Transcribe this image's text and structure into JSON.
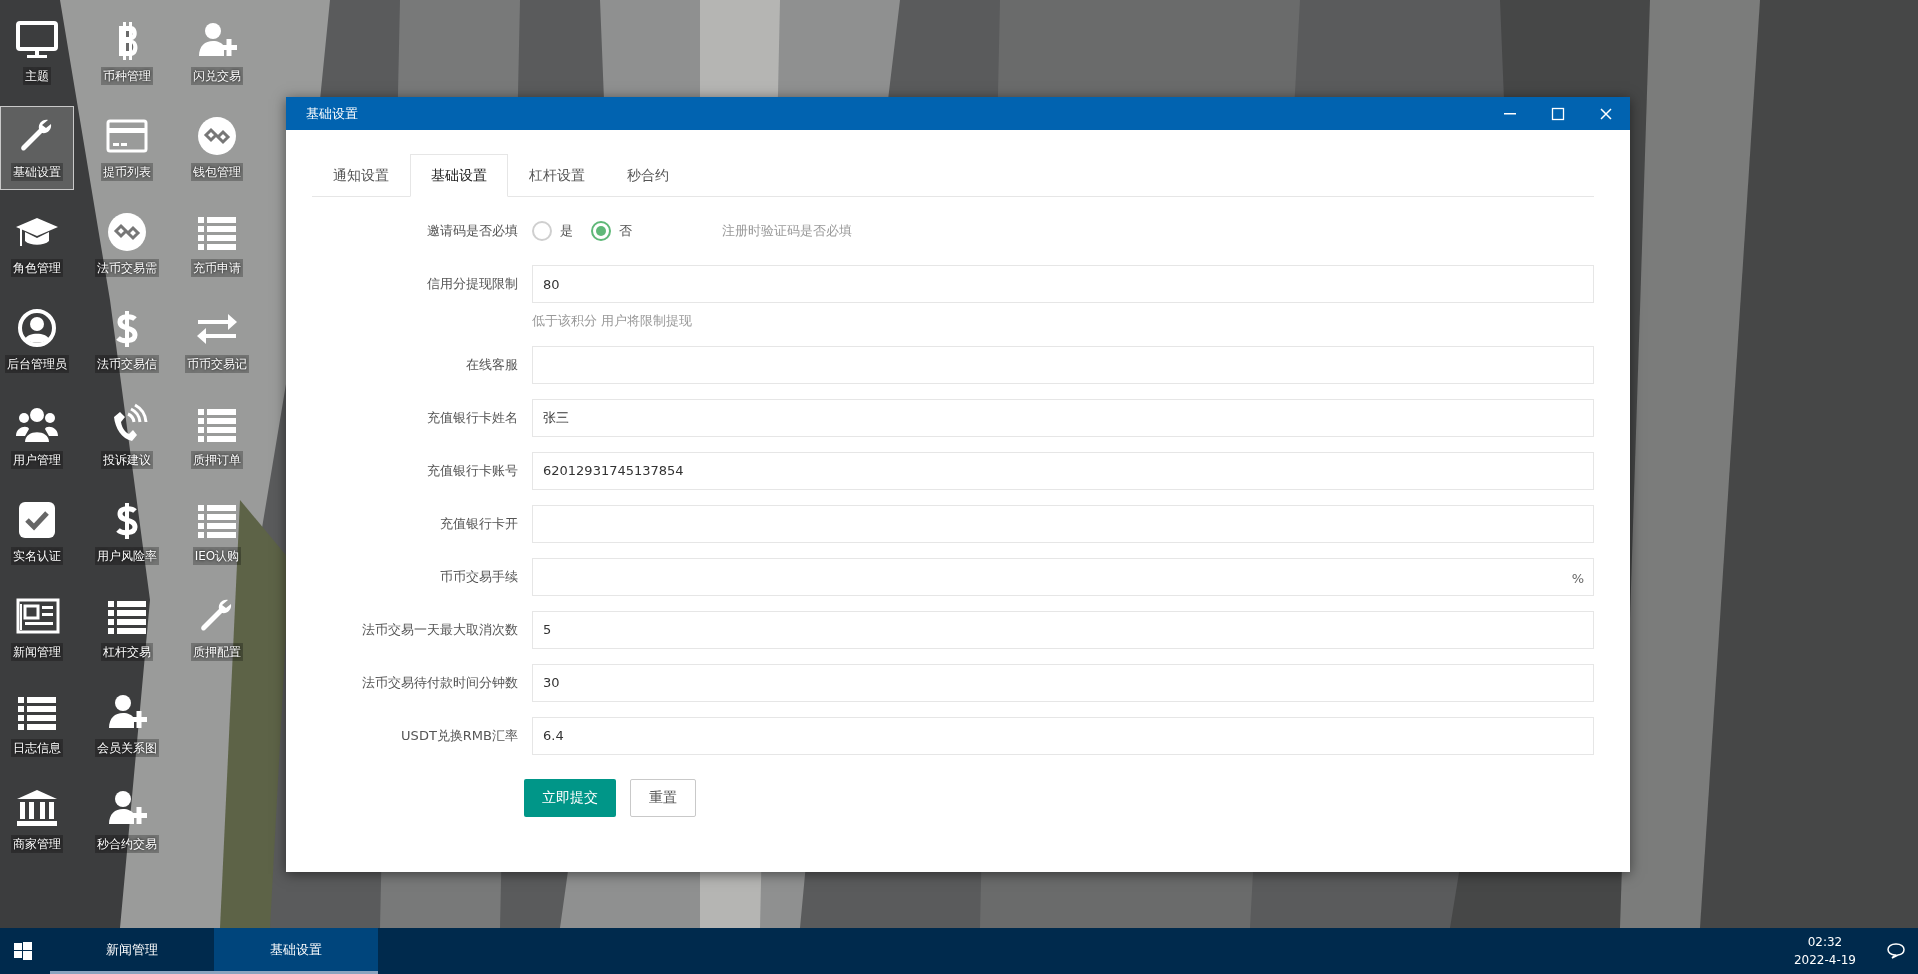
{
  "desktop_icons": [
    {
      "label": "主题",
      "kind": "monitor",
      "selected": false
    },
    {
      "label": "币种管理",
      "kind": "bitcoin",
      "selected": false
    },
    {
      "label": "闪兑交易",
      "kind": "user-plus",
      "selected": false
    },
    {
      "label": "基础设置",
      "kind": "wrench",
      "selected": true
    },
    {
      "label": "提币列表",
      "kind": "card",
      "selected": false
    },
    {
      "label": "钱包管理",
      "kind": "chain",
      "selected": false
    },
    {
      "label": "角色管理",
      "kind": "cap",
      "selected": false
    },
    {
      "label": "法币交易需",
      "kind": "chain",
      "selected": false
    },
    {
      "label": "充币申请",
      "kind": "list",
      "selected": false
    },
    {
      "label": "后台管理员",
      "kind": "user-circle",
      "selected": false
    },
    {
      "label": "法币交易信",
      "kind": "dollar",
      "selected": false
    },
    {
      "label": "币币交易记",
      "kind": "arrows",
      "selected": false
    },
    {
      "label": "用户管理",
      "kind": "users",
      "selected": false
    },
    {
      "label": "投诉建议",
      "kind": "phone",
      "selected": false
    },
    {
      "label": "质押订单",
      "kind": "list",
      "selected": false
    },
    {
      "label": "实名认证",
      "kind": "check",
      "selected": false
    },
    {
      "label": "用户风险率",
      "kind": "dollar",
      "selected": false
    },
    {
      "label": "IEO认购",
      "kind": "list",
      "selected": false
    },
    {
      "label": "新闻管理",
      "kind": "news",
      "selected": false
    },
    {
      "label": "杠杆交易",
      "kind": "list",
      "selected": false
    },
    {
      "label": "质押配置",
      "kind": "wrench",
      "selected": false
    },
    {
      "label": "日志信息",
      "kind": "list",
      "selected": false
    },
    {
      "label": "会员关系图",
      "kind": "user-plus",
      "selected": false
    },
    {
      "kind": "spacer"
    },
    {
      "label": "商家管理",
      "kind": "bank",
      "selected": false
    },
    {
      "label": "秒合约交易",
      "kind": "user-plus",
      "selected": false
    }
  ],
  "window": {
    "title": "基础设置",
    "tabs": [
      {
        "label": "通知设置",
        "selected": false
      },
      {
        "label": "基础设置",
        "selected": true
      },
      {
        "label": "杠杆设置",
        "selected": false
      },
      {
        "label": "秒合约",
        "selected": false
      }
    ],
    "rows": [
      {
        "kind": "radio",
        "label": "邀请码是否必填",
        "options": [
          {
            "label": "是",
            "selected": false
          },
          {
            "label": "否",
            "selected": true
          }
        ],
        "hint": "注册时验证码是否必填"
      },
      {
        "kind": "input",
        "label": "信用分提现限制",
        "value": "80",
        "help": "低于该积分 用户将限制提现"
      },
      {
        "kind": "input",
        "label": "在线客服"
      },
      {
        "kind": "input",
        "label": "充值银行卡姓名",
        "value": "张三"
      },
      {
        "kind": "input",
        "label": "充值银行卡账号",
        "value": "62012931745137854"
      },
      {
        "kind": "input",
        "label": "充值银行卡开"
      },
      {
        "kind": "input",
        "label": "币币交易手续",
        "suffix": "%"
      },
      {
        "kind": "input",
        "label": "法币交易一天最大取消次数",
        "value": "5"
      },
      {
        "kind": "input",
        "label": "法币交易待付款时间分钟数",
        "value": "30"
      },
      {
        "kind": "input",
        "label": "USDT兑换RMB汇率",
        "value": "6.4"
      }
    ],
    "buttons": [
      {
        "label": "立即提交",
        "kind": "primary"
      },
      {
        "label": "重置",
        "kind": "secondary"
      }
    ]
  },
  "taskbar": {
    "items": [
      {
        "label": "新闻管理",
        "selected": false
      },
      {
        "label": "基础设置",
        "selected": true
      }
    ],
    "time": "02:32",
    "date": "2022-4-19"
  }
}
